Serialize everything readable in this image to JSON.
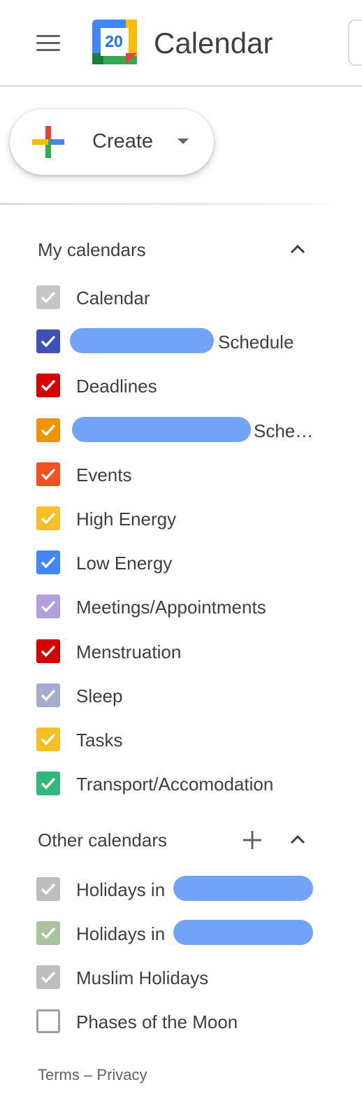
{
  "header": {
    "app_title": "Calendar",
    "logo_day": "20",
    "menu_icon": "hamburger-menu-icon"
  },
  "create": {
    "label": "Create",
    "icon": "plus-multicolor-icon"
  },
  "my_calendars": {
    "title": "My calendars",
    "items": [
      {
        "label": "Calendar",
        "color": "#c6c6c6",
        "checked": true
      },
      {
        "label": "Schedule",
        "color": "#3f51b5",
        "checked": true,
        "redacted": true
      },
      {
        "label": "Deadlines",
        "color": "#d50000",
        "checked": true
      },
      {
        "label": "Sche…",
        "color": "#f09300",
        "checked": true,
        "redacted": true
      },
      {
        "label": "Events",
        "color": "#f4511e",
        "checked": true
      },
      {
        "label": "High Energy",
        "color": "#f6bf26",
        "checked": true
      },
      {
        "label": "Low Energy",
        "color": "#4285f4",
        "checked": true
      },
      {
        "label": "Meetings/Appointments",
        "color": "#b39ddb",
        "checked": true
      },
      {
        "label": "Menstruation",
        "color": "#d50000",
        "checked": true
      },
      {
        "label": "Sleep",
        "color": "#a4acd0",
        "checked": true
      },
      {
        "label": "Tasks",
        "color": "#f6bf26",
        "checked": true
      },
      {
        "label": "Transport/Accomodation",
        "color": "#33b679",
        "checked": true
      }
    ]
  },
  "other_calendars": {
    "title": "Other calendars",
    "items": [
      {
        "label": "Holidays in",
        "color": "#bdbdbd",
        "checked": true,
        "redacted": true
      },
      {
        "label": "Holidays in",
        "color": "#a9c39e",
        "checked": true,
        "redacted": true
      },
      {
        "label": "Muslim Holidays",
        "color": "#bdbdbd",
        "checked": true
      },
      {
        "label": "Phases of the Moon",
        "color": "#9aa0a6",
        "checked": false
      }
    ]
  },
  "footer": {
    "terms": "Terms",
    "separator": "–",
    "privacy": "Privacy"
  }
}
